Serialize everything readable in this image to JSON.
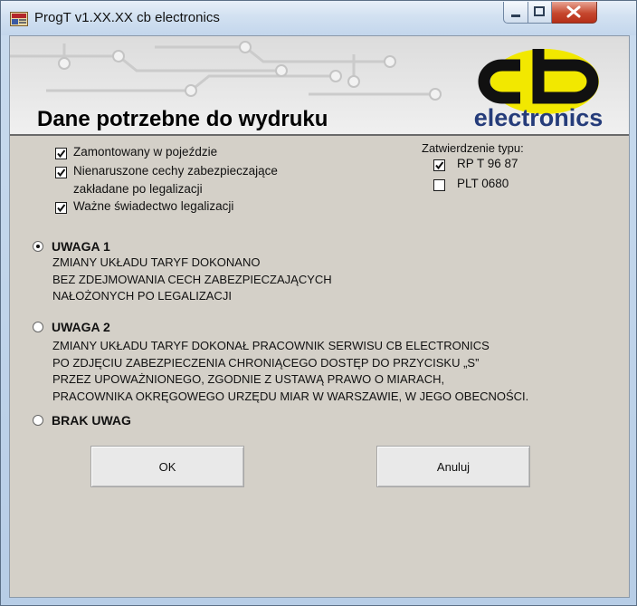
{
  "window": {
    "title": "ProgT v1.XX.XX  cb electronics"
  },
  "header": {
    "heading": "Dane potrzebne do wydruku",
    "logo_text": "electronics",
    "logo_colors": {
      "yellow": "#f2e800",
      "black": "#111111",
      "blue": "#253c7a"
    }
  },
  "checks": [
    {
      "label": "Zamontowany w pojeździe",
      "checked": true
    },
    {
      "label": "Nienaruszone cechy zabezpieczające",
      "label2": "zakładane po legalizacji",
      "checked": true
    },
    {
      "label": "Ważne świadectwo legalizacji",
      "checked": true
    }
  ],
  "approval": {
    "title": "Zatwierdzenie typu:",
    "items": [
      {
        "label": "RP T 96 87",
        "checked": true
      },
      {
        "label": "PLT 0680",
        "checked": false
      }
    ]
  },
  "notes": [
    {
      "label": "UWAGA 1",
      "selected": true,
      "lines": [
        "ZMIANY UKŁADU TARYF DOKONANO",
        "BEZ ZDEJMOWANIA CECH ZABEZPIECZAJĄCYCH",
        "NAŁOŻONYCH PO LEGALIZACJI"
      ]
    },
    {
      "label": "UWAGA 2",
      "selected": false,
      "lines": [
        "ZMIANY UKŁADU TARYF DOKONAŁ PRACOWNIK SERWISU CB ELECTRONICS",
        "PO ZDJĘCIU ZABEZPIECZENIA CHRONIĄCEGO DOSTĘP DO PRZYCISKU „S”",
        "PRZEZ UPOWAŻNIONEGO, ZGODNIE Z USTAWĄ PRAWO O MIARACH,",
        "PRACOWNIKA OKRĘGOWEGO URZĘDU MIAR W WARSZAWIE, W JEGO OBECNOŚCI."
      ]
    },
    {
      "label": "BRAK UWAG",
      "selected": false
    }
  ],
  "buttons": {
    "ok": "OK",
    "cancel": "Anuluj"
  }
}
